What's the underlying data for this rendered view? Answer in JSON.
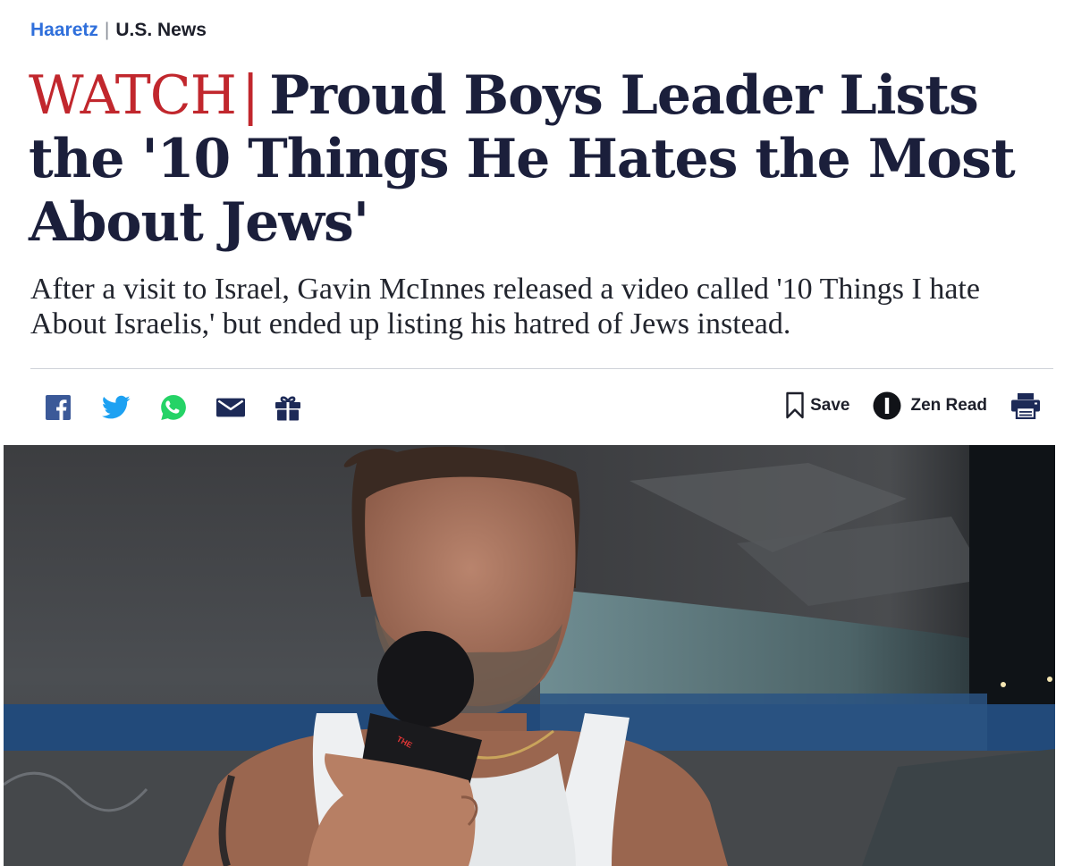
{
  "breadcrumb": {
    "site": "Haaretz",
    "separator": "|",
    "section": "U.S. News"
  },
  "article": {
    "kicker": "WATCH",
    "kicker_separator": "|",
    "headline": "Proud Boys Leader Lists the '10 Things He Hates the Most About Jews'",
    "subheadline": "After a visit to Israel, Gavin McInnes released a video called '10 Things I hate About Israelis,' but ended up listing his hatred of Jews instead."
  },
  "share_bar": [
    {
      "icon": "facebook-icon",
      "color": "#3b5998"
    },
    {
      "icon": "twitter-icon",
      "color": "#1da1f2"
    },
    {
      "icon": "whatsapp-icon",
      "color": "#25d366"
    },
    {
      "icon": "email-icon",
      "color": "#1d2a57"
    },
    {
      "icon": "gift-icon",
      "color": "#1d2a57"
    }
  ],
  "tools": {
    "save_label": "Save",
    "zen_read_label": "Zen Read",
    "print_icon": "printer-icon"
  },
  "hero_image": {
    "mic_flag_text": "THE"
  },
  "colors": {
    "link_blue": "#2f6fdb",
    "kicker_red": "#c1272d",
    "headline_navy": "#1b1f3b",
    "icon_navy": "#1d2a57"
  }
}
